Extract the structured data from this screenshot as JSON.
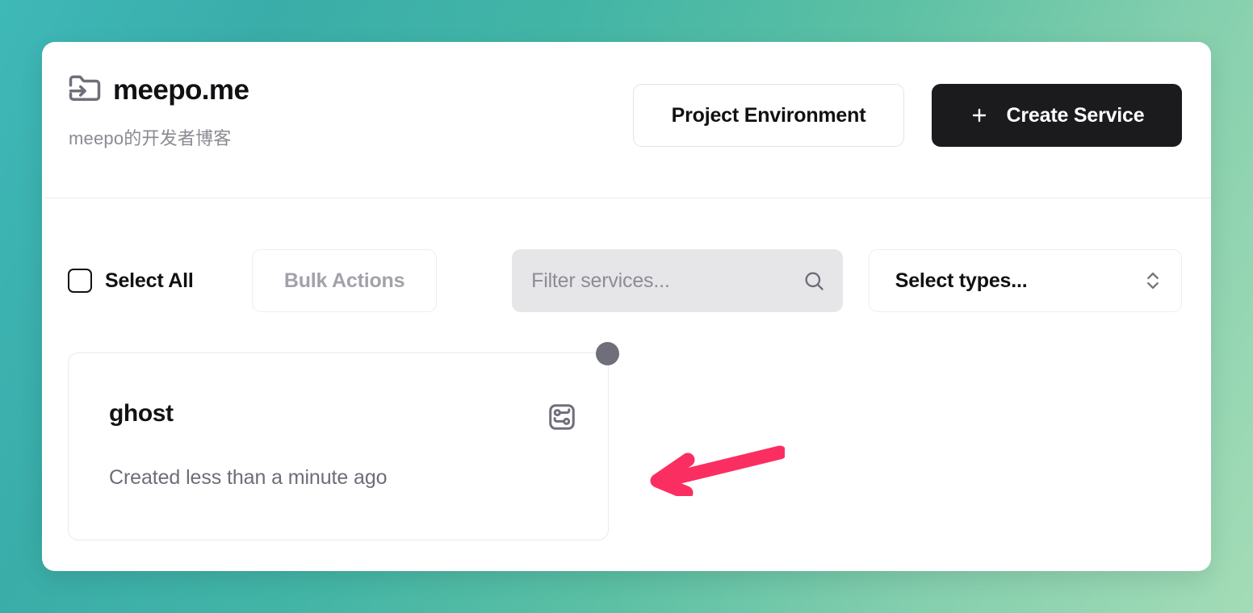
{
  "project": {
    "icon": "folder-input-icon",
    "title": "meepo.me",
    "subtitle": "meepo的开发者博客"
  },
  "header_actions": {
    "environment_label": "Project Environment",
    "create_service_label": "Create Service",
    "create_service_icon": "plus-icon"
  },
  "toolbar": {
    "select_all_label": "Select All",
    "select_all_checked": false,
    "bulk_actions_label": "Bulk Actions",
    "bulk_actions_disabled": true,
    "search": {
      "placeholder": "Filter services...",
      "value": "",
      "icon": "search-icon"
    },
    "type_filter": {
      "label": "Select types...",
      "icon": "chevrons-up-down-icon"
    }
  },
  "services": [
    {
      "name": "ghost",
      "meta": "Created less than a minute ago",
      "type_icon": "service-network-icon",
      "status_color": "#6f6f7c"
    }
  ],
  "annotation": {
    "type": "arrow",
    "direction": "left",
    "color": "#fb2e62",
    "points_at": "ghost-service-card"
  },
  "theme": {
    "background_gradient_start": "#3eb8b8",
    "background_gradient_end": "#a3dcb6",
    "panel_background": "#ffffff",
    "accent_dark": "#1b1b1e",
    "muted_text": "#8a8a93",
    "search_background": "#e6e6e9"
  }
}
